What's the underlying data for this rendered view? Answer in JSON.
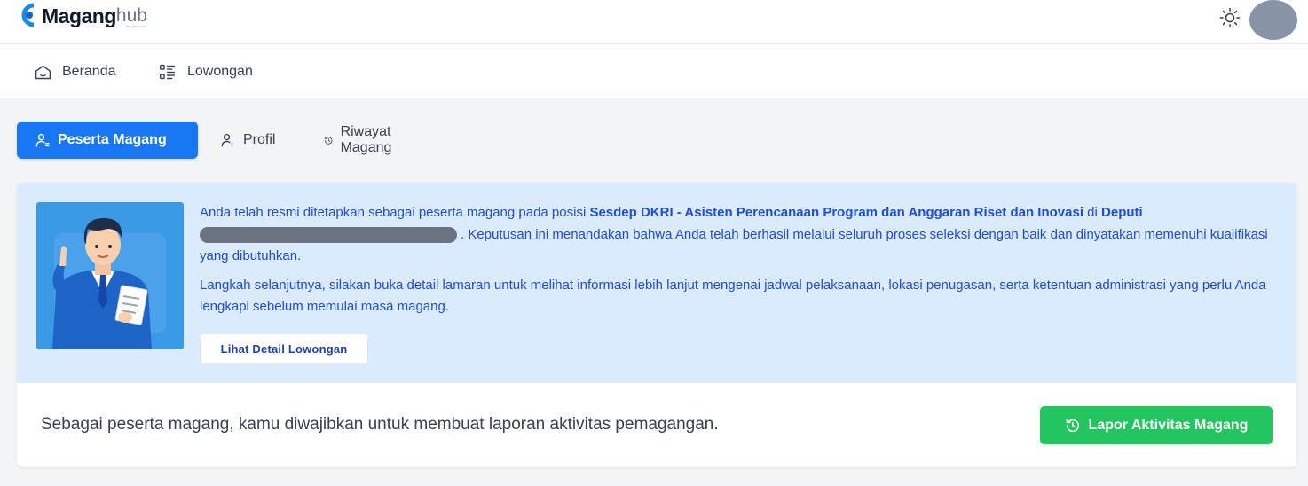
{
  "header": {
    "logo_text": "Magang",
    "logo_suffix": "hub",
    "logo_tagline": "Jalin Karier Anda",
    "theme_icon": "sun-icon",
    "avatar_color": "#8893a5"
  },
  "nav": {
    "items": [
      {
        "label": "Beranda",
        "icon": "home-icon"
      },
      {
        "label": "Lowongan",
        "icon": "list-icon"
      }
    ]
  },
  "tabs": [
    {
      "label": "Peserta Magang",
      "icon": "user-icon",
      "active": true
    },
    {
      "label": "Profil",
      "icon": "user-icon",
      "active": false
    },
    {
      "label": "Riwayat Magang",
      "icon": "history-icon",
      "active": false
    }
  ],
  "notice": {
    "p1_prefix": "Anda telah resmi ditetapkan sebagai peserta magang pada posisi ",
    "position": "Sesdep DKRI - Asisten Perencanaan Program dan Anggaran Riset dan Inovasi",
    "p1_mid": " di ",
    "unit": "Deputi",
    "p1_suffix": ". Keputusan ini menandakan bahwa Anda telah berhasil melalui seluruh proses seleksi dengan baik dan dinyatakan memenuhi kualifikasi yang dibutuhkan.",
    "p2": "Langkah selanjutnya, silakan buka detail lamaran untuk melihat informasi lebih lanjut mengenai jadwal pelaksanaan, lokasi penugasan, serta ketentuan administrasi yang perlu Anda lengkapi sebelum memulai masa magang.",
    "detail_button": "Lihat Detail Lowongan"
  },
  "report": {
    "text": "Sebagai peserta magang, kamu diwajibkan untuk membuat laporan aktivitas pemagangan.",
    "button": "Lapor Aktivitas Magang"
  },
  "colors": {
    "primary": "#1877f2",
    "success": "#22c55e",
    "notice_bg": "#dbeafe",
    "notice_text": "#1d4ed8"
  }
}
